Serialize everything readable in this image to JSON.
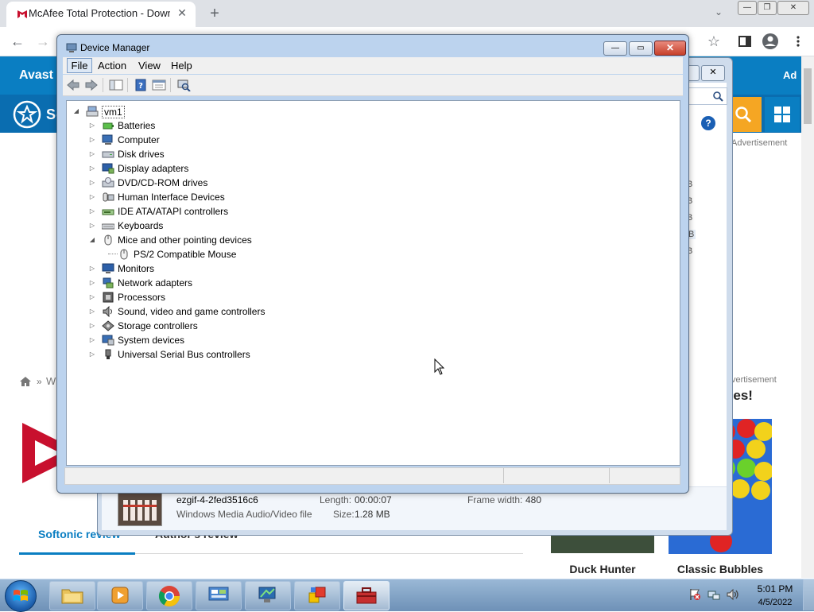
{
  "browser": {
    "tab_title": "McAfee Total Protection - Down",
    "tab_close": "✕",
    "new_tab": "+",
    "tab_search": "⌄",
    "win_min": "—",
    "win_restore": "❐",
    "win_close": "✕",
    "back": "←",
    "forward": "→",
    "star": "☆"
  },
  "website": {
    "header_text": "Avast",
    "header_ad": "Ad",
    "brand_text": "So",
    "advertisement_1": "Advertisement",
    "advertisement_2": "vertisement",
    "games_heading": "nes!",
    "crumb_sep": "»",
    "crumb_text": "W",
    "review_tabs": {
      "softonic": "Softonic review",
      "authors": "Author's review"
    },
    "games": [
      {
        "name": "Duck Hunter"
      },
      {
        "name": "Classic Bubbles"
      }
    ]
  },
  "background_window": {
    "close": "✕",
    "help": "?",
    "size_units": [
      "B",
      "B",
      "B",
      "B",
      "B"
    ],
    "file": {
      "name": "ezgif-4-2fed3516c6",
      "type": "Windows Media Audio/Video file",
      "length_label": "Length:",
      "length_value": "00:00:07",
      "size_label": "Size:",
      "size_value": "1.28 MB",
      "frame_width_label": "Frame width:",
      "frame_width_value": "480"
    }
  },
  "device_manager": {
    "title": "Device Manager",
    "controls": {
      "minimize": "—",
      "maximize": "▭",
      "close": "✕"
    },
    "menu": [
      {
        "label": "File"
      },
      {
        "label": "Action"
      },
      {
        "label": "View"
      },
      {
        "label": "Help"
      }
    ],
    "tree": {
      "root": "vm1",
      "items": [
        {
          "label": "Batteries",
          "icon": "battery-icon"
        },
        {
          "label": "Computer",
          "icon": "computer-icon"
        },
        {
          "label": "Disk drives",
          "icon": "disk-drive-icon"
        },
        {
          "label": "Display adapters",
          "icon": "display-adapter-icon"
        },
        {
          "label": "DVD/CD-ROM drives",
          "icon": "dvd-drive-icon"
        },
        {
          "label": "Human Interface Devices",
          "icon": "hid-icon"
        },
        {
          "label": "IDE ATA/ATAPI controllers",
          "icon": "ide-controller-icon"
        },
        {
          "label": "Keyboards",
          "icon": "keyboard-icon"
        },
        {
          "label": "Mice and other pointing devices",
          "icon": "mouse-icon",
          "expanded": true
        },
        {
          "label": "PS/2 Compatible Mouse",
          "icon": "mouse-icon",
          "child": true
        },
        {
          "label": "Monitors",
          "icon": "monitor-icon"
        },
        {
          "label": "Network adapters",
          "icon": "network-adapter-icon"
        },
        {
          "label": "Processors",
          "icon": "processor-icon"
        },
        {
          "label": "Sound, video and game controllers",
          "icon": "sound-icon"
        },
        {
          "label": "Storage controllers",
          "icon": "storage-controller-icon"
        },
        {
          "label": "System devices",
          "icon": "system-devices-icon"
        },
        {
          "label": "Universal Serial Bus controllers",
          "icon": "usb-icon"
        }
      ]
    }
  },
  "taskbar": {
    "time": "5:01 PM",
    "date": "4/5/2022"
  },
  "colors": {
    "site_blue": "#0a7ec2",
    "site_orange": "#f5a623",
    "window_frame": "#bcd3ee",
    "close_red": "#c7402b"
  }
}
